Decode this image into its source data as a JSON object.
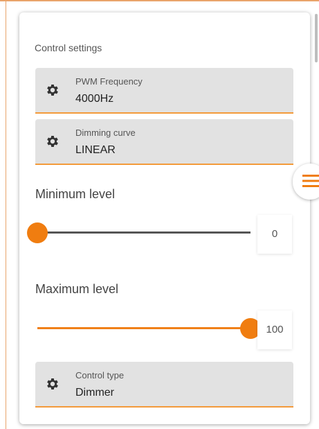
{
  "section_title": "Control settings",
  "fields": {
    "pwm_frequency": {
      "label": "PWM Frequency",
      "value": "4000Hz",
      "icon": "gear-icon"
    },
    "dimming_curve": {
      "label": "Dimming curve",
      "value": "LINEAR",
      "icon": "gear-icon"
    },
    "control_type": {
      "label": "Control type",
      "value": "Dimmer",
      "icon": "gear-icon"
    }
  },
  "minimum_level": {
    "label": "Minimum level",
    "value": "0",
    "min": 0,
    "max": 100
  },
  "maximum_level": {
    "label": "Maximum level",
    "value": "100",
    "min": 0,
    "max": 100
  },
  "side_menu": {
    "icon": "menu-icon"
  },
  "colors": {
    "accent": "#f07d10",
    "field_bg": "#e2e2e2",
    "track": "#555555"
  }
}
